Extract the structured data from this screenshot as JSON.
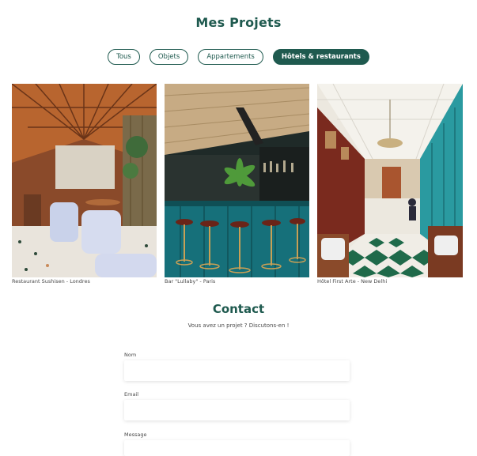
{
  "page": {
    "title": "Mes Projets"
  },
  "filters": [
    {
      "label": "Tous",
      "active": false
    },
    {
      "label": "Objets",
      "active": false
    },
    {
      "label": "Appartements",
      "active": false
    },
    {
      "label": "Hôtels & restaurants",
      "active": true
    }
  ],
  "projects": [
    {
      "caption": "Restaurant Sushisen - Londres"
    },
    {
      "caption": "Bar \"Lullaby\" - Paris"
    },
    {
      "caption": "Hôtel First Arte - New Delhi"
    }
  ],
  "contact": {
    "title": "Contact",
    "subtitle": "Vous avez un projet ? Discutons-en !",
    "fields": {
      "name_label": "Nom",
      "email_label": "Email",
      "message_label": "Message"
    }
  },
  "colors": {
    "accent": "#1f5a4f"
  }
}
